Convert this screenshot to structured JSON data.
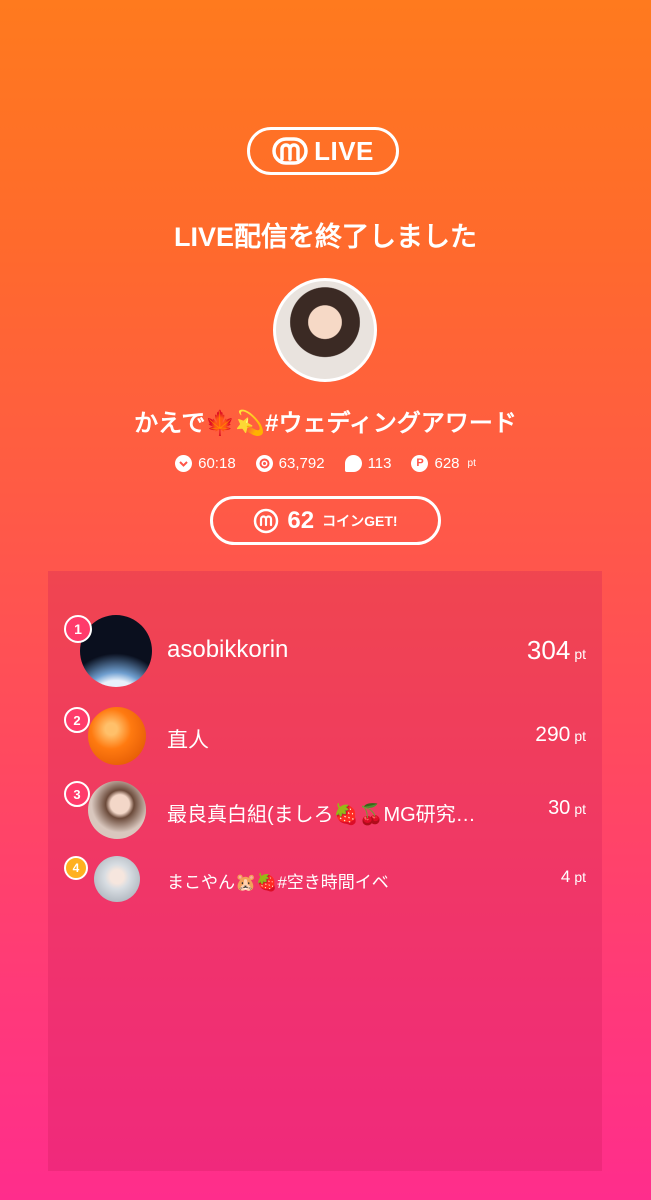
{
  "header": {
    "logo_text": "LIVE",
    "title": "LIVE配信を終了しました"
  },
  "streamer": {
    "name": "かえで🍁💫#ウェディングアワード"
  },
  "stats": {
    "duration": "60:18",
    "viewers": "63,792",
    "comments": "113",
    "points": "628",
    "points_unit": "pt"
  },
  "coin": {
    "amount": "62",
    "label": "コインGET!"
  },
  "ranking": [
    {
      "rank": "1",
      "name": "asobikkorin",
      "points": "304",
      "unit": "pt",
      "badge_color": "#ff3b6b"
    },
    {
      "rank": "2",
      "name": "直人",
      "points": "290",
      "unit": "pt",
      "badge_color": "#ff3b6b"
    },
    {
      "rank": "3",
      "name": "最良真白組(ましろ🍓🍒MG研究…",
      "points": "30",
      "unit": "pt",
      "badge_color": "#ff3b6b"
    },
    {
      "rank": "4",
      "name": "まこやん🐹🍓#空き時間イベ",
      "points": "4",
      "unit": "pt",
      "badge_color": "#ffb020"
    }
  ],
  "colors": {
    "gradient_top": "#ff7a1e",
    "gradient_bottom": "#ff2d8c",
    "rank_badge_top3": "#ff3b6b",
    "rank_badge_other": "#ffb020"
  }
}
